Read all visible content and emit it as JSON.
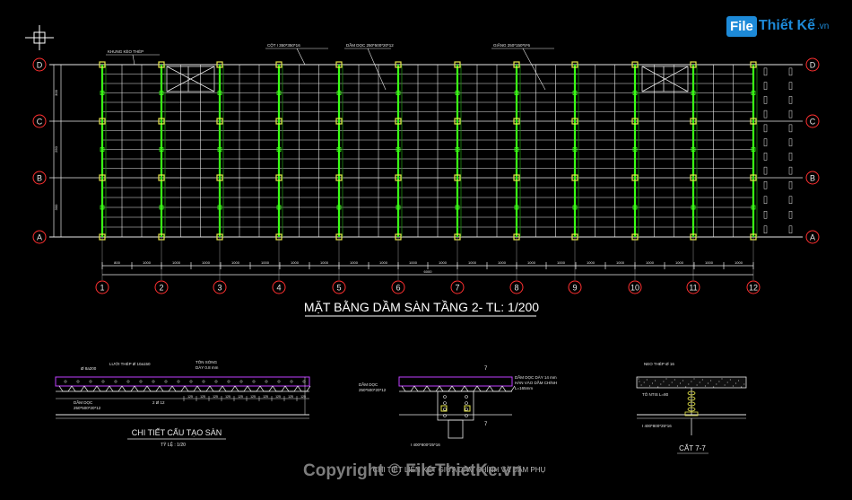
{
  "logo": {
    "box": "File",
    "text": "Thiết Kế",
    "suffix": ".vn"
  },
  "watermark": "Copyright © FileThietKe.vn",
  "plan_title": "MẶT BẰNG DẦM SÀN TẦNG 2- TL: 1/200",
  "axes_rows": [
    "D",
    "C",
    "B",
    "A"
  ],
  "axes_cols": [
    "1",
    "2",
    "3",
    "4",
    "5",
    "6",
    "7",
    "8",
    "9",
    "10",
    "11",
    "12"
  ],
  "plan_callouts": {
    "c1": "KHUNG KÈO THÉP",
    "c2": "CỘT I 350*350*16",
    "c3": "DẦM DỌC 250*500*20*12",
    "c4": "GIẰNG 250*150*5*6"
  },
  "dim_bottom": [
    "800",
    "1000",
    "1000",
    "1000",
    "1000",
    "1000",
    "1000",
    "1000",
    "1000",
    "1000",
    "1000",
    "1000",
    "1000",
    "1000",
    "1000",
    "1000",
    "1000",
    "1000",
    "1000",
    "1000",
    "1000",
    "1000"
  ],
  "dim_total": "6000",
  "dim_left": [
    "300",
    "250",
    "300"
  ],
  "detail1": {
    "title": "CHI TIẾT CẤU TẠO SÀN",
    "subtitle": "TỶ LỆ : 1/20",
    "labels": {
      "a": "Ø 8a200",
      "b": "LƯỚI THÉP Ø 10a150",
      "c": "TÔN SÓNG DÀY 0.8 mm",
      "d": "2 Ø 12",
      "e": "DẦM DỌC 250*500*20*12"
    }
  },
  "detail2": {
    "title": "CHI TIẾT LIÊN KẾT GIỮA DẦM CHÍNH VÀ DẦM PHỤ",
    "labels": {
      "a": "DẦM DỌC 250*500*20*12",
      "b": "DẦM DỌC DÀY 14 mm HÀN VÀO DẦM CHÍNH",
      "c": "I 400*800*25*16"
    },
    "section_mark": "7"
  },
  "detail3": {
    "title": "CẮT 7-7",
    "labels": {
      "a": "NEO THÉP Ø 16",
      "b": "TÔ NTIS L=80",
      "c": "I 400*800*25*16"
    }
  }
}
